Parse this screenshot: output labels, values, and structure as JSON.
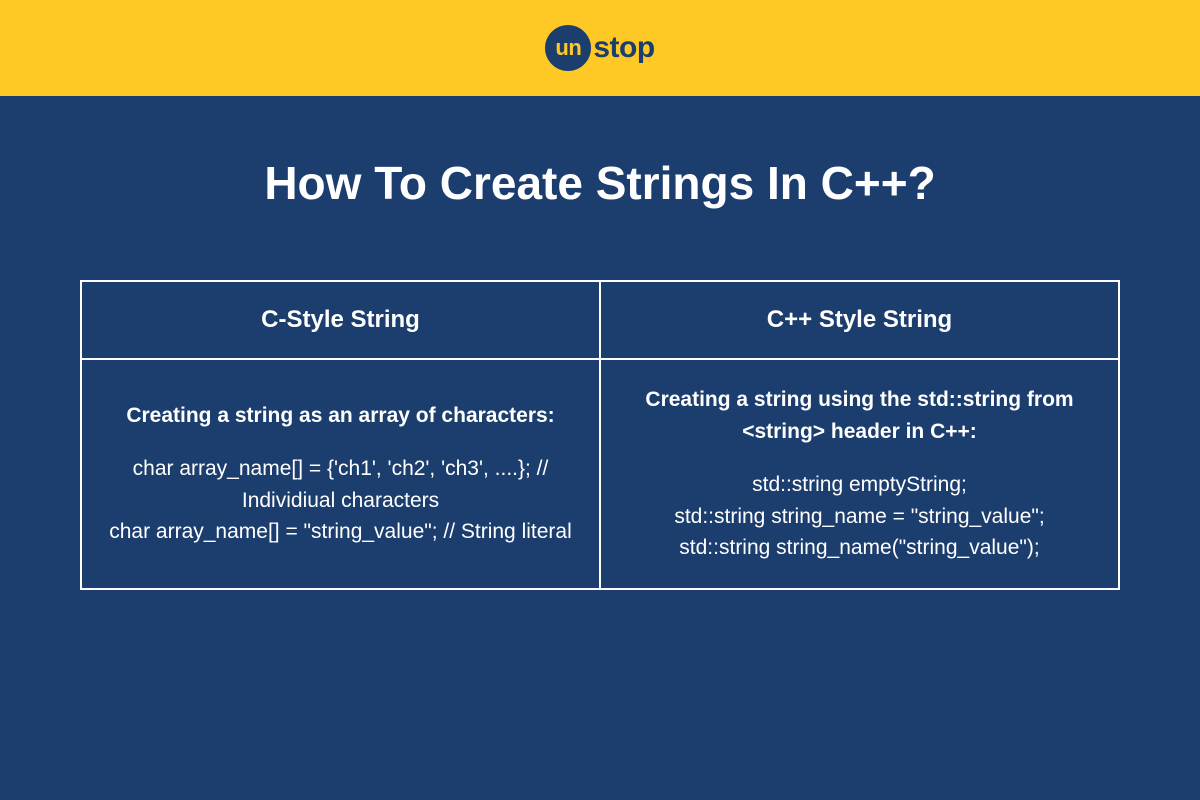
{
  "logo": {
    "circle_text": "un",
    "rest_text": "stop"
  },
  "title": "How To Create Strings In C++?",
  "table": {
    "header_left": "C-Style String",
    "header_right": "C++ Style String",
    "left": {
      "heading": "Creating a string as an array of characters:",
      "line1": "char array_name[] = {'ch1', 'ch2', 'ch3', ....}; // Individiual characters",
      "line2": "char array_name[] = \"string_value\";  // String literal"
    },
    "right": {
      "heading": "Creating a string using the std::string from <string> header in C++:",
      "line1": "std::string emptyString;",
      "line2": "std::string string_name = \"string_value\";",
      "line3": "std::string string_name(\"string_value\");"
    }
  }
}
